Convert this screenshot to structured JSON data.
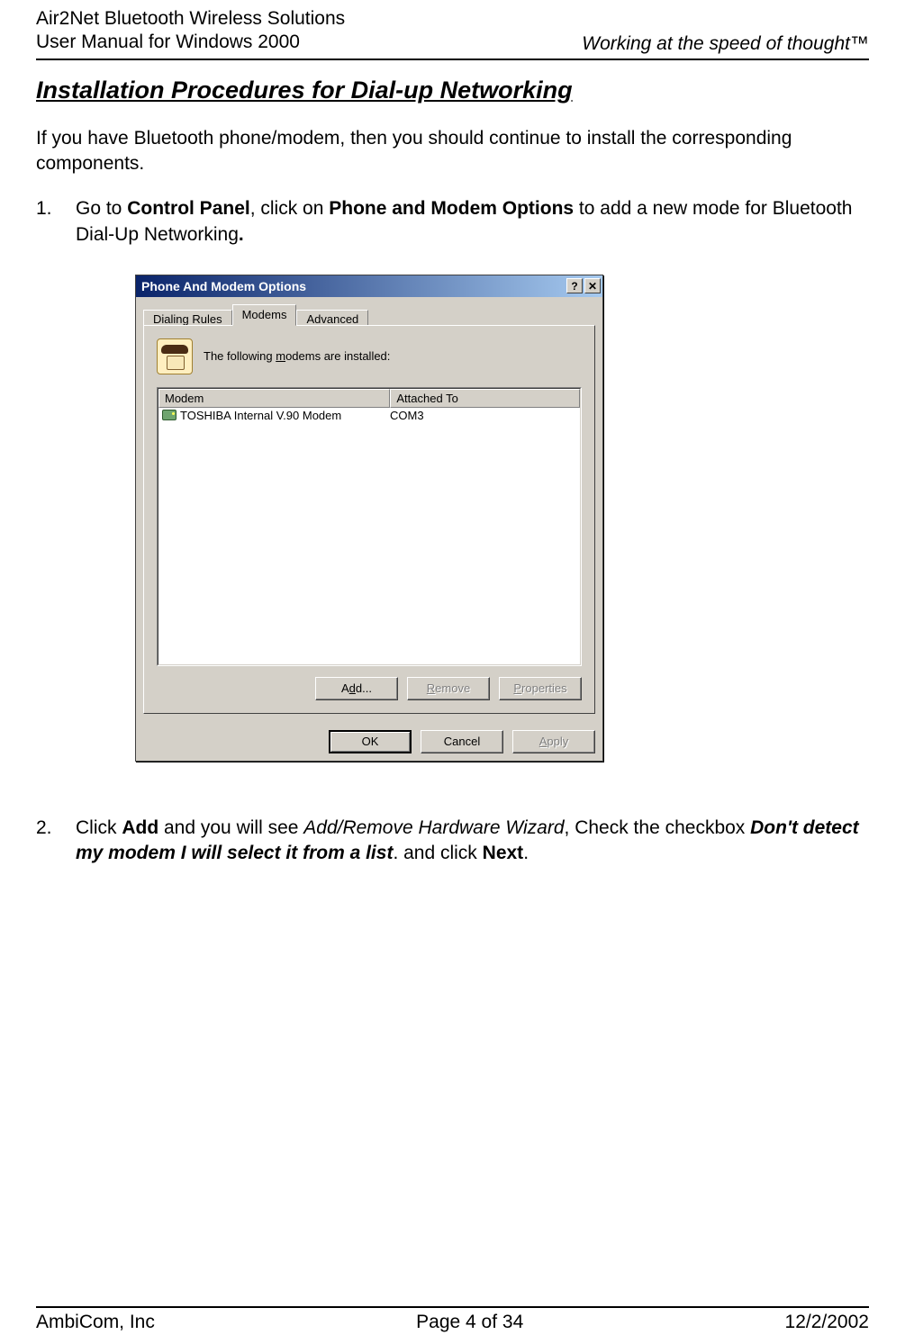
{
  "header": {
    "left_line1": "Air2Net Bluetooth Wireless Solutions",
    "left_line2": "User Manual for Windows 2000",
    "right": "Working at the speed of thought™"
  },
  "section_title": "Installation Procedures for Dial-up Networking",
  "intro": "If you have Bluetooth phone/modem, then you should continue to install the corresponding components.",
  "step1": {
    "num": "1.",
    "t1": "Go to ",
    "b1": "Control Panel",
    "t2": ", click on ",
    "b2": "Phone and Modem Options",
    "t3": " to add a new mode for Bluetooth Dial-Up Networking",
    "dot": "."
  },
  "step2": {
    "num": "2.",
    "t1": "Click ",
    "b1": "Add",
    "t2": " and you will see ",
    "i1": "Add/Remove Hardware Wizard",
    "t3": ", Check the checkbox ",
    "bi1": "Don't detect my modem I will select it from a list",
    "t4": ". and click ",
    "b2": "Next",
    "t5": "."
  },
  "dialog": {
    "title": "Phone And Modem Options",
    "help_glyph": "?",
    "close_glyph": "✕",
    "tabs": [
      "Dialing Rules",
      "Modems",
      "Advanced"
    ],
    "active_tab_index": 1,
    "panel_text_pre": "The following ",
    "panel_text_uchar": "m",
    "panel_text_post": "odems are  installed:",
    "columns": [
      "Modem",
      "Attached To"
    ],
    "rows": [
      {
        "name": "TOSHIBA Internal V.90 Modem",
        "port": "COM3"
      }
    ],
    "buttons_inner": [
      {
        "pre": "A",
        "u": "d",
        "post": "d...",
        "disabled": false
      },
      {
        "pre": "",
        "u": "R",
        "post": "emove",
        "disabled": true
      },
      {
        "pre": "",
        "u": "P",
        "post": "roperties",
        "disabled": true
      }
    ],
    "buttons_outer": [
      {
        "pre": "OK",
        "u": "",
        "post": "",
        "disabled": false,
        "default": true
      },
      {
        "pre": "Cancel",
        "u": "",
        "post": "",
        "disabled": false,
        "default": false
      },
      {
        "pre": "",
        "u": "A",
        "post": "pply",
        "disabled": true,
        "default": false
      }
    ]
  },
  "footer": {
    "left": "AmbiCom, Inc",
    "center": "Page 4 of 34",
    "right": "12/2/2002"
  }
}
